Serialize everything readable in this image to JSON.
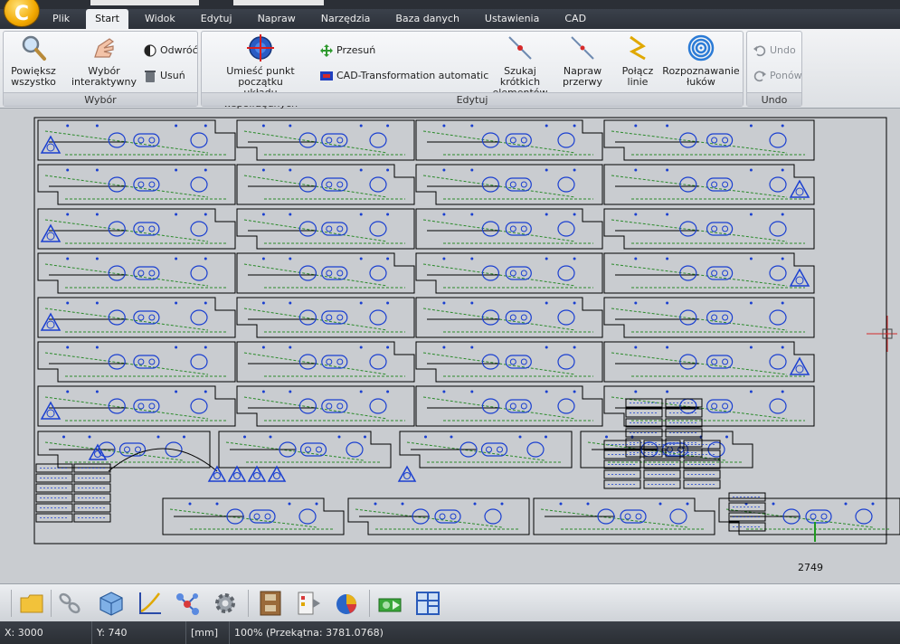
{
  "app": {
    "logo_letter": "C"
  },
  "tabs": [
    {
      "label": "Plik",
      "active": false
    },
    {
      "label": "Start",
      "active": true
    },
    {
      "label": "Widok",
      "active": false
    },
    {
      "label": "Edytuj",
      "active": false
    },
    {
      "label": "Napraw",
      "active": false
    },
    {
      "label": "Narzędzia",
      "active": false
    },
    {
      "label": "Baza danych",
      "active": false
    },
    {
      "label": "Ustawienia",
      "active": false
    },
    {
      "label": "CAD",
      "active": false
    }
  ],
  "ribbon": {
    "wybor": {
      "label": "Wybór",
      "zoom_all": "Powiększ\nwszystko",
      "interactive": "Wybór\ninteraktywny",
      "invert": "Odwróć",
      "delete": "Usuń"
    },
    "edytuj": {
      "label": "Edytuj",
      "origin": "Umieść punkt początku\nukładu współrzędnych",
      "move": "Przesuń",
      "cad_transform": "CAD-Transformation automatic",
      "short_elements": "Szukaj krótkich\nelementów",
      "fix_gaps": "Napraw\nprzerwy",
      "join_lines": "Połącz\nlinie",
      "arc_recognition": "Rozpoznawanie\nłuków"
    },
    "undo": {
      "label": "Undo",
      "undo": "Undo",
      "redo": "Ponów"
    }
  },
  "canvas": {
    "coordinate_label": "2749",
    "colors": {
      "outline": "#000000",
      "holes": "#1a3fd0",
      "dashed": "#2a8a2a",
      "background": "#c9ccd0"
    }
  },
  "bottom_toolbar": {
    "icons": [
      "folder-icon",
      "chain-icon",
      "cube-icon",
      "axis-icon",
      "nodes-icon",
      "gear-icon",
      "film-icon",
      "document-play-icon",
      "pie-chart-icon",
      "gear-play-icon",
      "layout-icon"
    ]
  },
  "status": {
    "x": "X: 3000",
    "y": "Y: 740",
    "unit": "[mm]",
    "zoom": "100% (Przekątna: 3781.0768)"
  }
}
